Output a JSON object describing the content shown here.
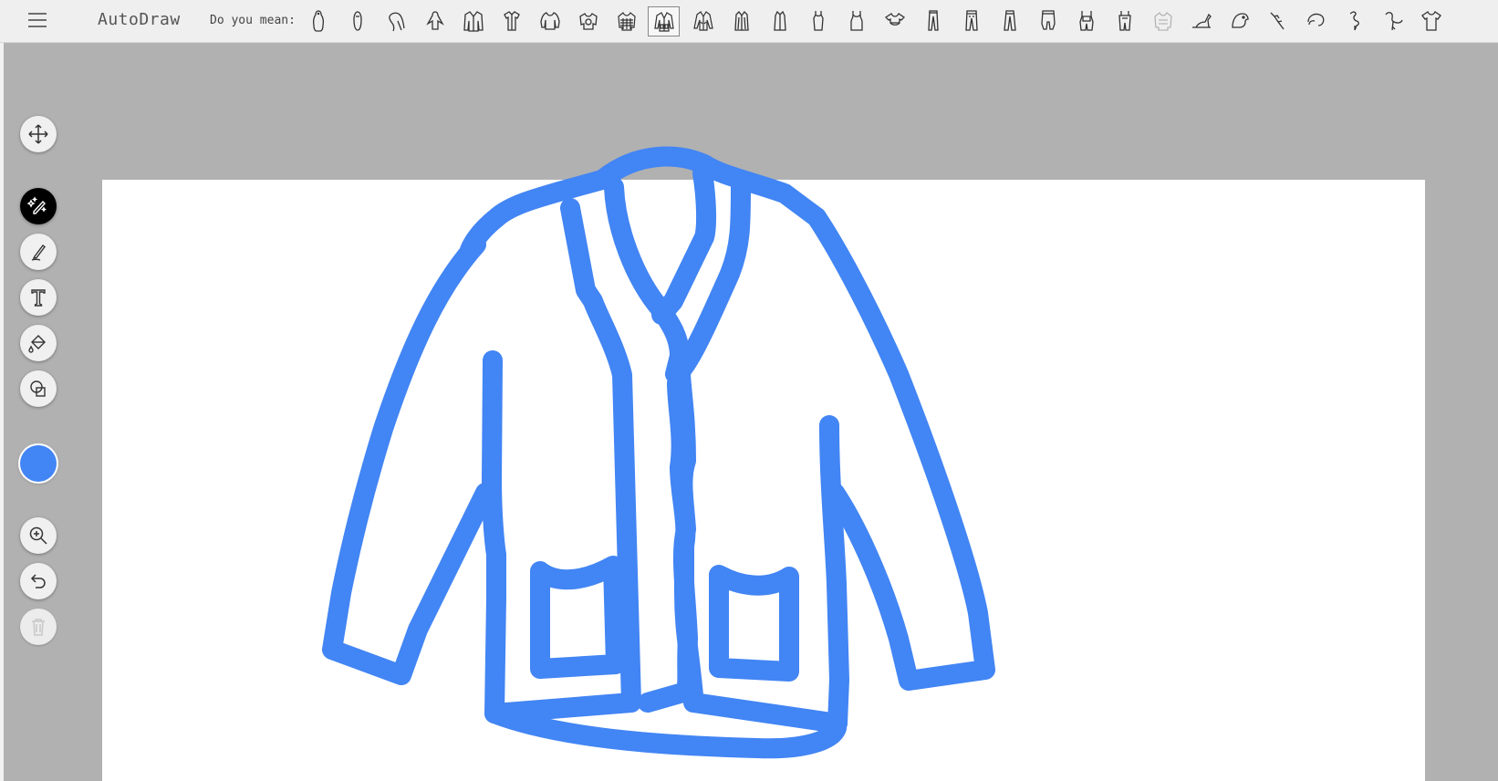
{
  "app": {
    "title": "AutoDraw"
  },
  "toolbar": {
    "menu_icon": "hamburger-menu-icon",
    "suggest_label": "Do you mean:",
    "suggestions": [
      "penguin-icon",
      "penguin-icon",
      "penguin-icon",
      "penguin-icon",
      "jacket-icon",
      "shirt-icon",
      "sweater-icon",
      "sweater-icon",
      "sweater-icon",
      "cardigan-icon",
      "jacket-icon",
      "coat-icon",
      "coat-icon",
      "dress-icon",
      "tank-top-icon",
      "shirt-icon",
      "pants-icon",
      "pants-icon",
      "pants-icon",
      "pants-icon",
      "overalls-icon",
      "overalls-icon",
      "sweater-icon",
      "bird-icon",
      "parrot-icon",
      "bird-icon",
      "flamingo-icon",
      "flamingo-icon",
      "flamingo-icon",
      "tshirt-icon"
    ],
    "selected_index": 9
  },
  "tools": [
    {
      "name": "select",
      "icon": "move-arrows-icon"
    },
    {
      "name": "autodraw",
      "icon": "magic-pencil-icon",
      "active": true
    },
    {
      "name": "draw",
      "icon": "pencil-icon"
    },
    {
      "name": "type",
      "icon": "text-icon"
    },
    {
      "name": "fill",
      "icon": "paint-bucket-icon"
    },
    {
      "name": "shape",
      "icon": "shapes-icon"
    },
    {
      "name": "zoom",
      "icon": "zoom-in-icon"
    },
    {
      "name": "undo",
      "icon": "undo-icon"
    },
    {
      "name": "delete",
      "icon": "trash-icon",
      "disabled": true
    }
  ],
  "colors": {
    "selected_color": "#4285f4",
    "canvas": "#ffffff",
    "background": "#b1b1b1"
  },
  "drawing": {
    "subject": "cardigan",
    "stroke_color": "#4285f4"
  }
}
